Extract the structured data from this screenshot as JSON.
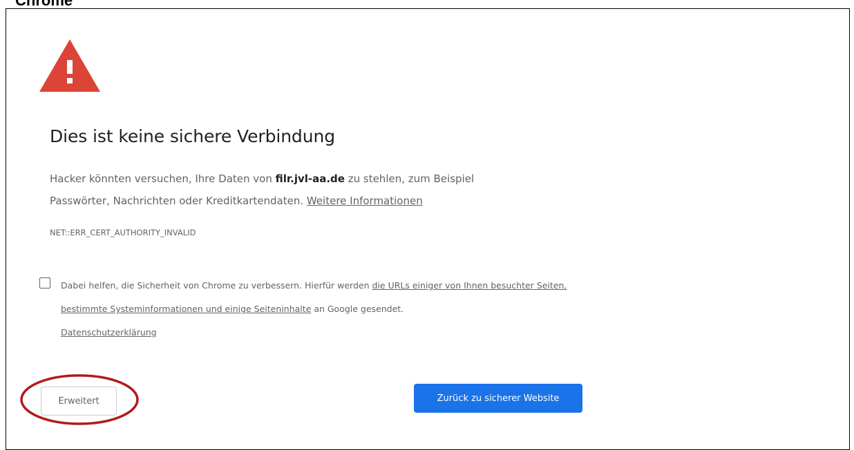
{
  "document_label": "Chrome",
  "page": {
    "heading": "Dies ist keine sichere Verbindung",
    "description": {
      "part1": "Hacker könnten versuchen, Ihre Daten von ",
      "host": "filr.jvl-aa.de",
      "part2": " zu stehlen, zum Beispiel Passwörter, Nachrichten oder Kreditkartendaten. ",
      "learn_more_link": "Weitere Informationen"
    },
    "error_code": "NET::ERR_CERT_AUTHORITY_INVALID",
    "opt_in": {
      "checked": false,
      "text_part1": "Dabei helfen, die Sicherheit von Chrome zu verbessern. Hierfür werden ",
      "link1": "die URLs einiger von Ihnen besuchter Seiten, bestimmte Systeminformationen und einige Seiteninhalte",
      "text_part2": " an Google gesendet. ",
      "privacy_link": "Datenschutzerklärung"
    },
    "buttons": {
      "advanced": "Erweitert",
      "back_to_safety": "Zurück zu sicherer Website"
    }
  },
  "icons": {
    "warning": "warning-triangle-icon"
  },
  "colors": {
    "warning_red": "#db4437",
    "primary_blue": "#1a73e8",
    "highlight_ring": "#b01a1e",
    "body_text": "#5f6368"
  }
}
